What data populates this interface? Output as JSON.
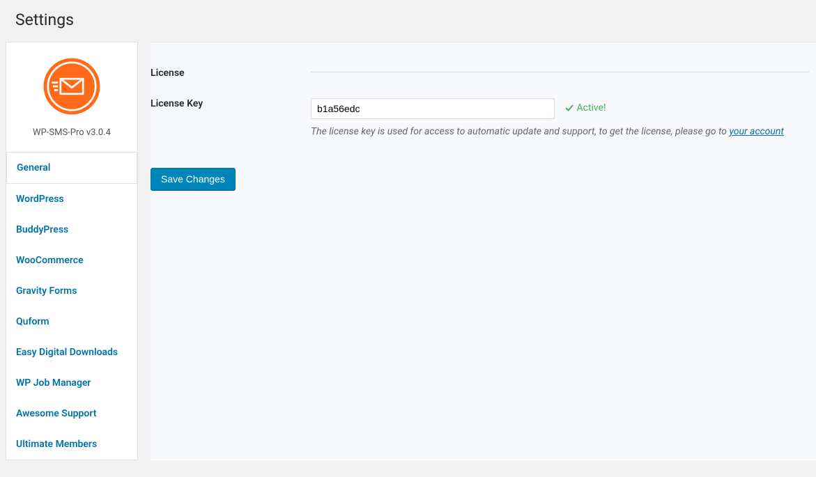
{
  "page": {
    "title": "Settings"
  },
  "product": {
    "name": "WP-SMS-Pro v3.0.4"
  },
  "nav": {
    "items": [
      {
        "label": "General",
        "active": true
      },
      {
        "label": "WordPress"
      },
      {
        "label": "BuddyPress"
      },
      {
        "label": "WooCommerce"
      },
      {
        "label": "Gravity Forms"
      },
      {
        "label": "Quform"
      },
      {
        "label": "Easy Digital Downloads"
      },
      {
        "label": "WP Job Manager"
      },
      {
        "label": "Awesome Support"
      },
      {
        "label": "Ultimate Members"
      }
    ]
  },
  "form": {
    "section_title": "License",
    "license_key_label": "License Key",
    "license_key_value": "b1a56edc",
    "status_text": "Active!",
    "help_text": "The license key is used for access to automatic update and support, to get the license, please go to ",
    "help_link_text": "your account",
    "save_button": "Save Changes"
  }
}
